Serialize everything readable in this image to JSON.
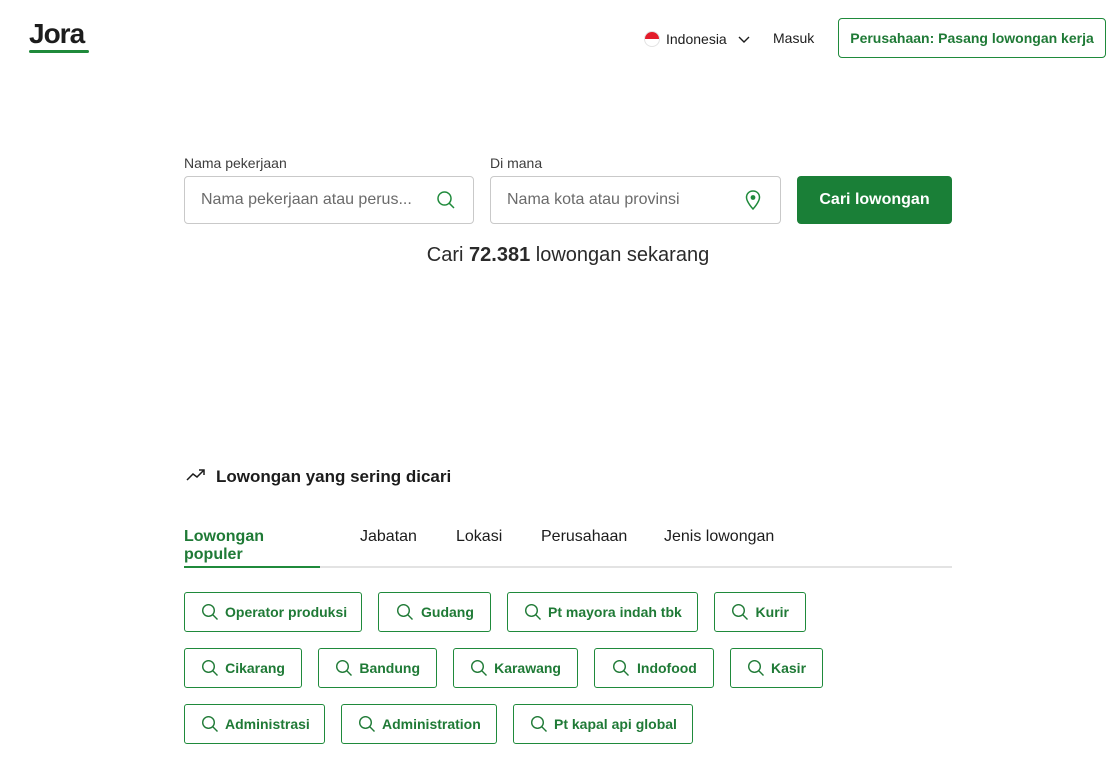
{
  "header": {
    "logo": "Jora",
    "country": "Indonesia",
    "login": "Masuk",
    "employer_button": "Perusahaan: Pasang lowongan kerja"
  },
  "search": {
    "what_label": "Nama pekerjaan",
    "what_placeholder": "Nama pekerjaan atau perus...",
    "where_label": "Di mana",
    "where_placeholder": "Nama kota atau provinsi",
    "button": "Cari lowongan"
  },
  "job_count": {
    "prefix": "Cari",
    "count": "72.381",
    "suffix": "lowongan sekarang"
  },
  "popular": {
    "title": "Lowongan yang sering dicari",
    "tabs": [
      "Lowongan populer",
      "Jabatan",
      "Lokasi",
      "Perusahaan",
      "Jenis lowongan"
    ],
    "active_tab": "Lowongan populer",
    "chips": [
      "Operator produksi",
      "Gudang",
      "Pt mayora indah tbk",
      "Kurir",
      "Cikarang",
      "Bandung",
      "Karawang",
      "Indofood",
      "Kasir",
      "Administrasi",
      "Administration",
      "Pt kapal api global"
    ]
  },
  "colors": {
    "brand_green": "#1a7f37",
    "text_dark": "#1c1c1c"
  },
  "icons": [
    "search-icon",
    "location-pin-icon",
    "chevron-down-icon",
    "trending-up-icon",
    "flag-icon"
  ]
}
